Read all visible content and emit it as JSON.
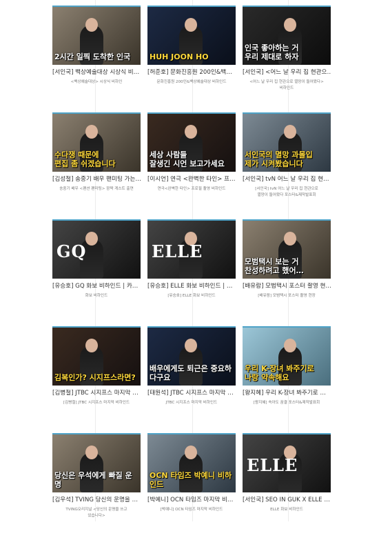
{
  "cards": [
    {
      "title": "[서인국] 백상예술대상 시상식 비…",
      "desc": "<백상예술대상> 시상식 비하인",
      "caption": "2시간 일찍 도착한 인국",
      "style": "room"
    },
    {
      "title": "[허준호] 문화진흥원 200인&백…",
      "desc": "문화진흥원 200인&백상예술대상 비하인드",
      "caption": "HUH JOON HO",
      "style": "blue"
    },
    {
      "title": "[서인국] <어느 날 우리 집 현관으…",
      "desc": "<어느 날 우리 집 현관으로 멸망이 들어왔다>\n비하인드",
      "caption": "인국 좋아하는 거\n우리 제대로 하자",
      "style": "dark"
    },
    {
      "title": "[김성철] 송중기 배우 팬미팅 가는…",
      "desc": "송중기 배우 <팬션 팬미팅> 깜짝 게스트 출연",
      "caption": "수다쟁 때문에\n편집 좀 쉬겠습니다",
      "style": "room"
    },
    {
      "title": "[이시언] 연극 <완벽한 타인> 프…",
      "desc": "연극<완벽한 타인> 프로필 촬영 비하인드",
      "caption": "세상 사람들\n잘생긴 시언 보고가세요",
      "style": "warm"
    },
    {
      "title": "[서인국] tvN 어느 날 우리 집 현…",
      "desc": "[서인국] tvN 어느 날 우리 집 현관으로\n멸망이 들어왔다 포스터&제작발표회",
      "caption": "서인국의 멸망 과몰입\n제가 시켜봤습니다",
      "style": "light"
    },
    {
      "title": "[유승호] GQ 화보 비하인드 | 카…",
      "desc": "화보 비하인드",
      "caption": "GQ",
      "style": "film"
    },
    {
      "title": "[유승호] ELLE 화보 비하인드 | …",
      "desc": "[유승호] ELLE 화보 비하인드",
      "caption": "ELLE",
      "style": "film"
    },
    {
      "title": "[배유람] 모범택시 포스터 촬영 현…",
      "desc": "[배유람] 모범택시 포스터 촬영 현장",
      "caption": "모범택시 보는 거\n찬성하려고 했어…",
      "style": "room"
    },
    {
      "title": "[김병철] JTBC 시지프스 마지막 …",
      "desc": "[김병철] JTBC 시지프스 마지막 비하인드",
      "caption": "김복인가? 시지프스라면?",
      "style": "warm"
    },
    {
      "title": "[태원석] JTBC 시지프스 마지막 …",
      "desc": "JTBC 시지프스 마지막 비하인드",
      "caption": "배우에게도 퇴근은 중요하다구요",
      "style": "blue"
    },
    {
      "title": "[왕지혜] 우리 K-장녀 봐주기로 …",
      "desc": "[왕지혜] 속아도 꿈결 포스터&제작발표회",
      "caption": "우리 K-장녀 봐주기로\n나랑 약속해요",
      "style": "sky"
    },
    {
      "title": "[김우석] TVING 당신의 운명을 …",
      "desc": "TVING오리지널 <당신의 운명을 쓰고\n있습니다>",
      "caption": "당신은 우석에게 빠질 운명",
      "style": "room"
    },
    {
      "title": "[박예니] OCN 타임즈 마지막 비…",
      "desc": "[박예니] OCN 타임즈 마지막 비하인드",
      "caption": "OCN 타임즈 박예니 비하인드",
      "style": "light"
    },
    {
      "title": "[서인국] SEO IN GUK X ELLE …",
      "desc": "ELLE 화보 비하인드",
      "caption": "ELLE",
      "style": "film"
    }
  ]
}
